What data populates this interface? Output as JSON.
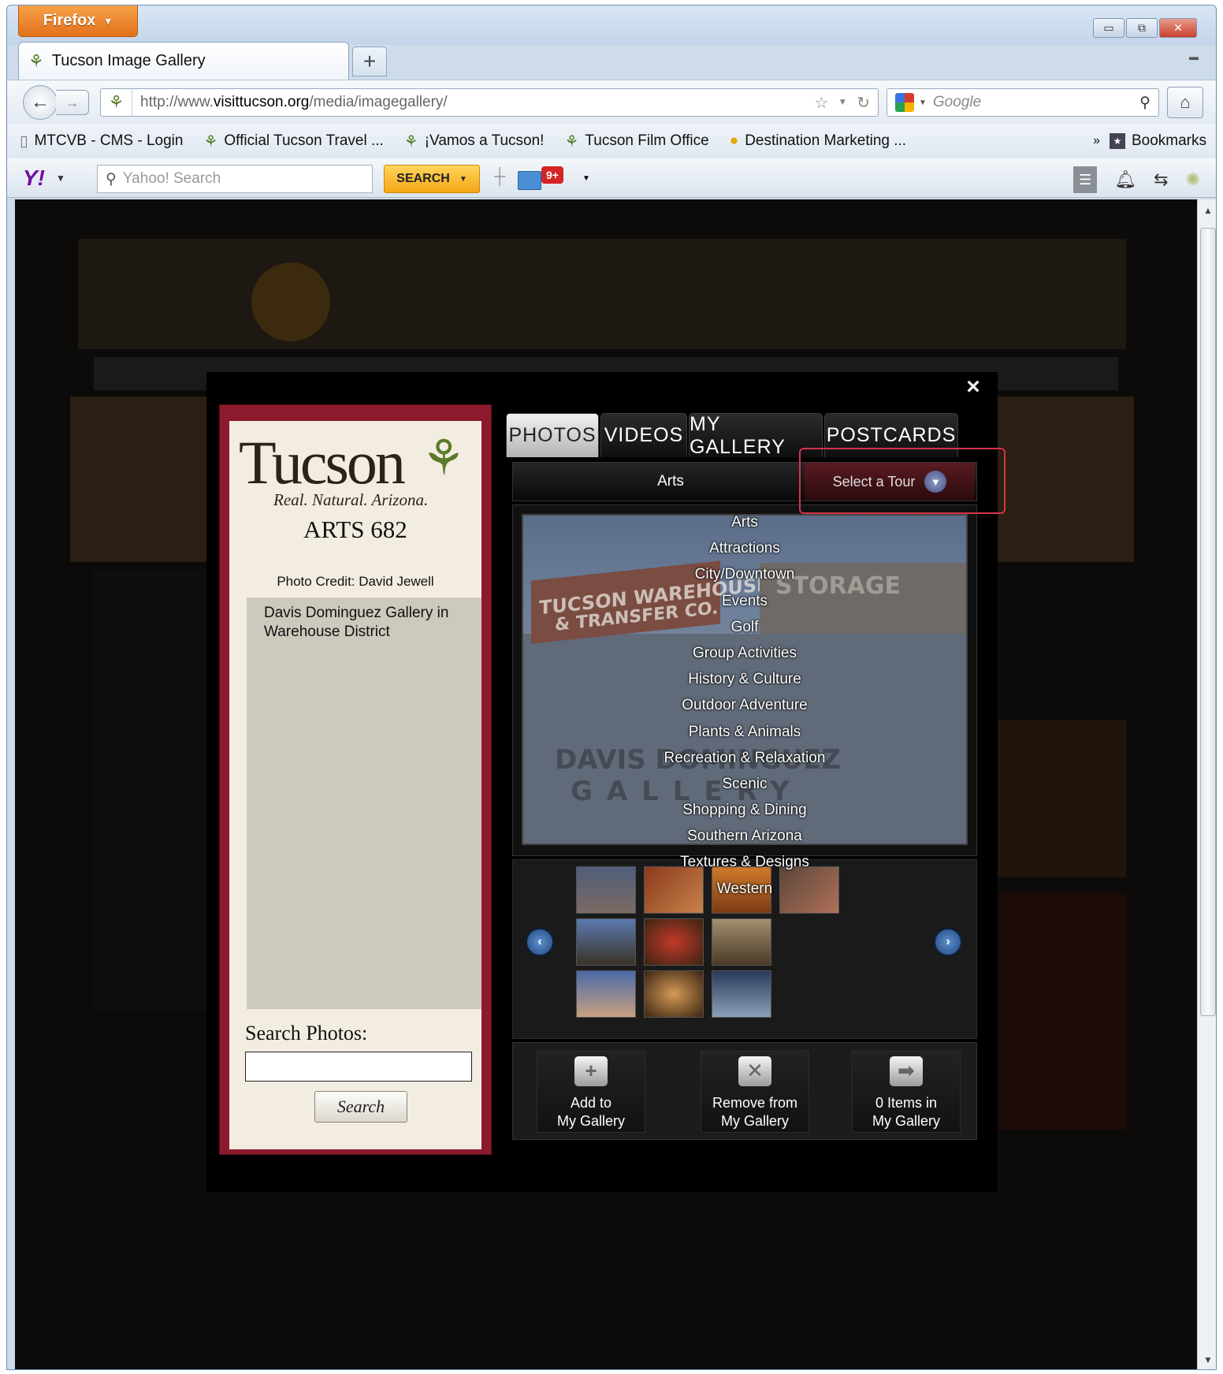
{
  "browser": {
    "menu_button": "Firefox",
    "tab_title": "Tucson Image Gallery",
    "url_prefix": "http://www.",
    "url_domain": "visittucson.org",
    "url_path": "/media/imagegallery/",
    "search_placeholder": "Google",
    "bookmarks": [
      {
        "label": "MTCVB - CMS - Login",
        "icon": "page-icon"
      },
      {
        "label": "Official Tucson Travel ...",
        "icon": "cactus-icon"
      },
      {
        "label": "¡Vamos a Tucson!",
        "icon": "cactus-icon"
      },
      {
        "label": "Tucson Film Office",
        "icon": "cactus-icon"
      },
      {
        "label": "Destination Marketing ...",
        "icon": "person-icon"
      }
    ],
    "bookmarks_menu": "Bookmarks",
    "yahoo_search_placeholder": "Yahoo! Search",
    "yahoo_search_button": "SEARCH",
    "mail_badge": "9+"
  },
  "gallery": {
    "logo_text": "Tucson",
    "logo_tagline": "Real. Natural. Arizona.",
    "image_title": "ARTS 682",
    "photo_credit": "Photo Credit: David Jewell",
    "description": "Davis Dominguez Gallery in Warehouse District",
    "search_label": "Search Photos:",
    "search_value": "",
    "search_button": "Search",
    "tabs": [
      "PHOTOS",
      "VIDEOS",
      "MY GALLERY",
      "POSTCARDS"
    ],
    "active_tab": "PHOTOS",
    "current_category": "Arts",
    "tour_button": "Select a Tour",
    "tours": [
      "Arts",
      "Attractions",
      "City/Downtown",
      "Events",
      "Golf",
      "Group Activities",
      "History & Culture",
      "Outdoor Adventure",
      "Plants & Animals",
      "Recreation & Relaxation",
      "Scenic",
      "Shopping & Dining",
      "Southern Arizona",
      "Textures & Designs",
      "Western"
    ],
    "actions": {
      "add_line1": "Add to",
      "add_line2": "My Gallery",
      "remove_line1": "Remove from",
      "remove_line2": "My Gallery",
      "count_line1": "0 Items in",
      "count_line2": "My Gallery"
    },
    "close_glyph": "×"
  }
}
